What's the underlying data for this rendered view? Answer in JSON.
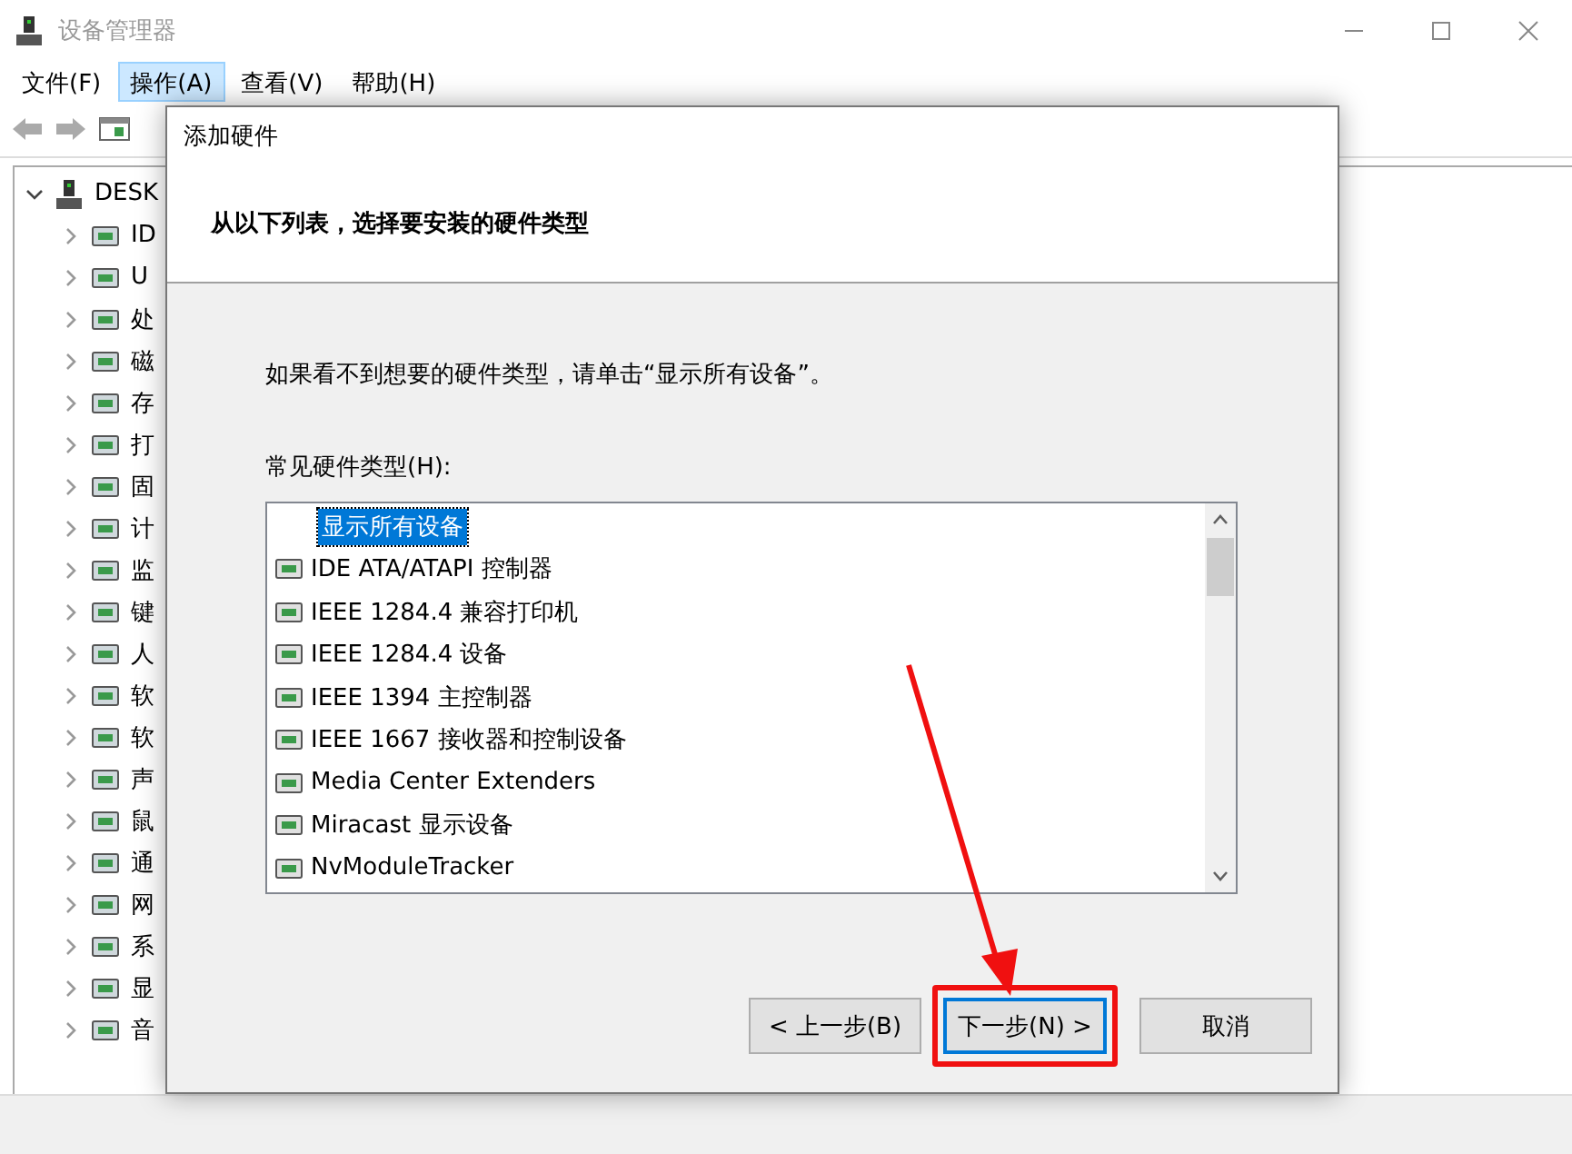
{
  "window": {
    "title": "设备管理器"
  },
  "menu": [
    {
      "label": "文件(F)",
      "selected": false
    },
    {
      "label": "操作(A)",
      "selected": true
    },
    {
      "label": "查看(V)",
      "selected": false
    },
    {
      "label": "帮助(H)",
      "selected": false
    }
  ],
  "tree": {
    "label": "DESK",
    "expanded": true,
    "children": [
      {
        "label": "ID",
        "expanded": false
      },
      {
        "label": "U",
        "expanded": false
      },
      {
        "label": "处",
        "expanded": false
      },
      {
        "label": "磁",
        "expanded": false
      },
      {
        "label": "存",
        "expanded": false
      },
      {
        "label": "打",
        "expanded": false
      },
      {
        "label": "固",
        "expanded": false
      },
      {
        "label": "计",
        "expanded": false
      },
      {
        "label": "监",
        "expanded": false
      },
      {
        "label": "键",
        "expanded": false
      },
      {
        "label": "人",
        "expanded": false
      },
      {
        "label": "软",
        "expanded": false
      },
      {
        "label": "软",
        "expanded": false
      },
      {
        "label": "声",
        "expanded": false
      },
      {
        "label": "鼠",
        "expanded": false
      },
      {
        "label": "通",
        "expanded": false
      },
      {
        "label": "网",
        "expanded": false
      },
      {
        "label": "系",
        "expanded": false
      },
      {
        "label": "显",
        "expanded": false
      },
      {
        "label": "音",
        "expanded": false
      }
    ]
  },
  "dialog": {
    "title": "添加硬件",
    "heading": "从以下列表，选择要安装的硬件类型",
    "hint": "如果看不到想要的硬件类型，请单击“显示所有设备”。",
    "list_label": "常见硬件类型(H):",
    "items": [
      {
        "label": "显示所有设备",
        "selected": true
      },
      {
        "label": "IDE ATA/ATAPI 控制器",
        "selected": false
      },
      {
        "label": "IEEE 1284.4 兼容打印机",
        "selected": false
      },
      {
        "label": "IEEE 1284.4 设备",
        "selected": false
      },
      {
        "label": "IEEE 1394 主控制器",
        "selected": false
      },
      {
        "label": "IEEE 1667 接收器和控制设备",
        "selected": false
      },
      {
        "label": "Media Center Extenders",
        "selected": false
      },
      {
        "label": "Miracast 显示设备",
        "selected": false
      },
      {
        "label": "NvModuleTracker",
        "selected": false
      }
    ],
    "buttons": [
      {
        "label": "< 上一步(B)",
        "default": false,
        "highlighted": false
      },
      {
        "label": "下一步(N) >",
        "default": true,
        "highlighted": true
      },
      {
        "label": "取消",
        "default": false,
        "highlighted": false
      }
    ]
  }
}
